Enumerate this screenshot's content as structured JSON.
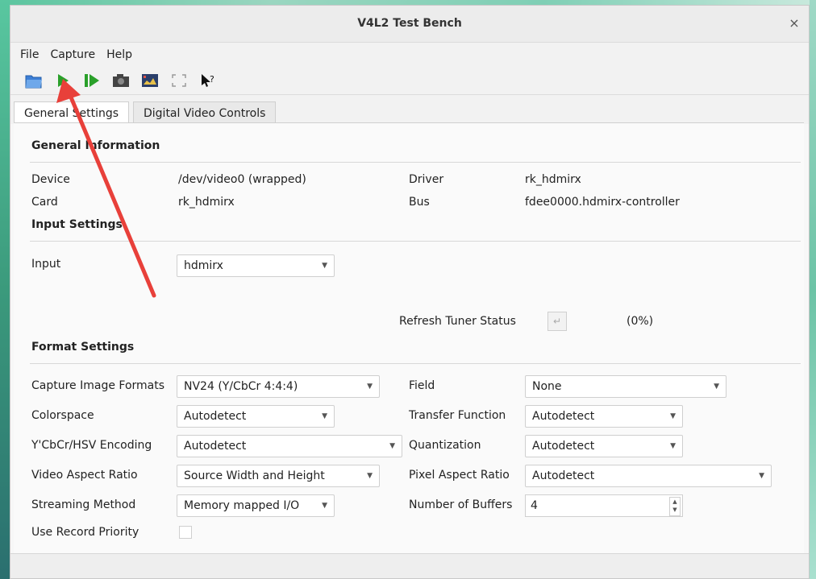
{
  "window": {
    "title": "V4L2 Test Bench",
    "close_glyph": "×"
  },
  "menu": {
    "items": [
      "File",
      "Capture",
      "Help"
    ]
  },
  "toolbar": {
    "icons": [
      "open-icon",
      "play-icon",
      "step-icon",
      "camera-icon",
      "screenshot-icon",
      "fullscreen-icon",
      "whats-this-icon"
    ]
  },
  "tabs": [
    "General Settings",
    "Digital Video Controls"
  ],
  "general_info": {
    "heading": "General Information",
    "device_label": "Device",
    "device_value": "/dev/video0 (wrapped)",
    "card_label": "Card",
    "card_value": "rk_hdmirx",
    "driver_label": "Driver",
    "driver_value": "rk_hdmirx",
    "bus_label": "Bus",
    "bus_value": "fdee0000.hdmirx-controller"
  },
  "input_settings": {
    "heading": "Input Settings",
    "input_label": "Input",
    "input_value": "hdmirx",
    "refresh_label": "Refresh Tuner Status",
    "refresh_percent": "(0%)"
  },
  "format_settings": {
    "heading": "Format Settings",
    "capture_formats_label": "Capture Image Formats",
    "capture_formats_value": "NV24 (Y/CbCr 4:4:4)",
    "field_label": "Field",
    "field_value": "None",
    "colorspace_label": "Colorspace",
    "colorspace_value": "Autodetect",
    "transfer_label": "Transfer Function",
    "transfer_value": "Autodetect",
    "encoding_label": "Y'CbCr/HSV Encoding",
    "encoding_value": "Autodetect",
    "quantization_label": "Quantization",
    "quantization_value": "Autodetect",
    "video_aspect_label": "Video Aspect Ratio",
    "video_aspect_value": "Source Width and Height",
    "pixel_aspect_label": "Pixel Aspect Ratio",
    "pixel_aspect_value": "Autodetect",
    "streaming_label": "Streaming Method",
    "streaming_value": "Memory mapped I/O",
    "buffers_label": "Number of Buffers",
    "buffers_value": "4",
    "record_priority_label": "Use Record Priority"
  },
  "colors": {
    "annotation_arrow": "#e8403a",
    "play_green": "#2aa02a"
  }
}
